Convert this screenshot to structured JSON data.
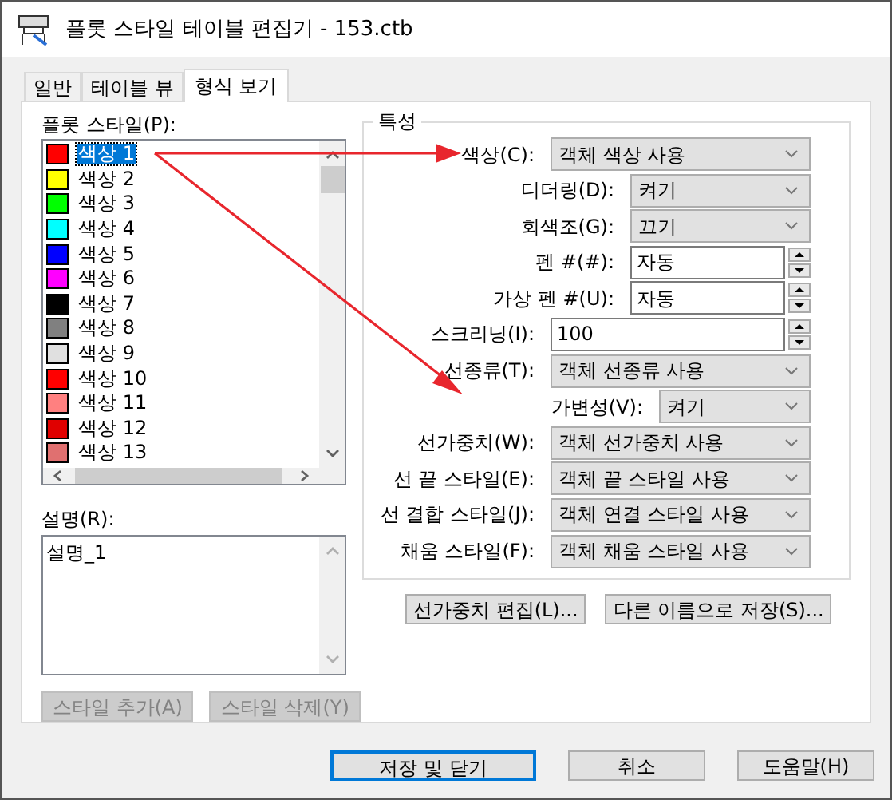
{
  "window": {
    "title": "플롯 스타일 테이블 편집기 - 153.ctb"
  },
  "tabs": [
    {
      "label": "일반",
      "selected": false
    },
    {
      "label": "테이블 뷰",
      "selected": false
    },
    {
      "label": "형식 보기",
      "selected": true
    }
  ],
  "plot_styles": {
    "label": "플롯 스타일(P):",
    "items": [
      {
        "name": "색상 1",
        "color": "#ff0000",
        "selected": true
      },
      {
        "name": "색상 2",
        "color": "#ffff00",
        "selected": false
      },
      {
        "name": "색상 3",
        "color": "#00ff00",
        "selected": false
      },
      {
        "name": "색상 4",
        "color": "#00ffff",
        "selected": false
      },
      {
        "name": "색상 5",
        "color": "#0000ff",
        "selected": false
      },
      {
        "name": "색상 6",
        "color": "#ff00ff",
        "selected": false
      },
      {
        "name": "색상 7",
        "color": "#000000",
        "selected": false
      },
      {
        "name": "색상 8",
        "color": "#808080",
        "selected": false
      },
      {
        "name": "색상 9",
        "color": "#e0e0e0",
        "selected": false
      },
      {
        "name": "색상 10",
        "color": "#ff0000",
        "selected": false
      },
      {
        "name": "색상 11",
        "color": "#ff8080",
        "selected": false
      },
      {
        "name": "색상 12",
        "color": "#e00000",
        "selected": false
      },
      {
        "name": "색상 13",
        "color": "#e07070",
        "selected": false
      }
    ]
  },
  "description": {
    "label": "설명(R):",
    "value": "설명_1"
  },
  "style_buttons": [
    {
      "label": "스타일 추가(A)",
      "disabled": true
    },
    {
      "label": "스타일 삭제(Y)",
      "disabled": true
    }
  ],
  "properties": {
    "title": "특성",
    "rows": [
      {
        "label": "색상(C):",
        "value": "객체 색상 사용",
        "kind": "dropdown"
      },
      {
        "label": "디더링(D):",
        "value": "켜기",
        "kind": "short-dropdown"
      },
      {
        "label": "회색조(G):",
        "value": "끄기",
        "kind": "short-dropdown"
      },
      {
        "label": "펜 #(#):",
        "value": "자동",
        "kind": "short-spinner"
      },
      {
        "label": "가상 펜 #(U):",
        "value": "자동",
        "kind": "short-spinner"
      },
      {
        "label": "스크리닝(I):",
        "value": "100",
        "kind": "spinner"
      },
      {
        "label": "선종류(T):",
        "value": "객체 선종류 사용",
        "kind": "dropdown"
      },
      {
        "label": "가변성(V):",
        "value": "켜기",
        "kind": "tiny-dropdown"
      },
      {
        "label": "선가중치(W):",
        "value": "객체 선가중치 사용",
        "kind": "dropdown"
      },
      {
        "label": "선 끝 스타일(E):",
        "value": "객체 끝 스타일 사용",
        "kind": "dropdown"
      },
      {
        "label": "선 결합 스타일(J):",
        "value": "객체 연결 스타일 사용",
        "kind": "dropdown"
      },
      {
        "label": "채움 스타일(F):",
        "value": "객체 채움 스타일 사용",
        "kind": "dropdown"
      }
    ]
  },
  "property_buttons": [
    "선가중치 편집(L)...",
    "다른 이름으로 저장(S)..."
  ],
  "dialog_buttons": [
    {
      "label": "저장 및 닫기",
      "selected": true
    },
    {
      "label": "취소",
      "selected": false
    },
    {
      "label": "도움말(H)",
      "selected": false
    }
  ]
}
